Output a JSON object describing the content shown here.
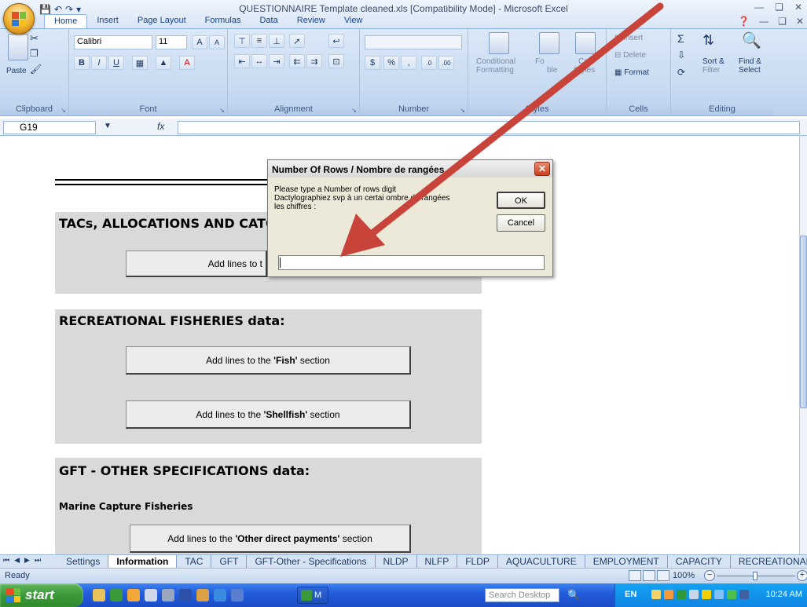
{
  "window": {
    "title": "QUESTIONNAIRE Template cleaned.xls  [Compatibility Mode] - Microsoft Excel"
  },
  "ribbon_tabs": [
    {
      "label": "Home"
    },
    {
      "label": "Insert"
    },
    {
      "label": "Page Layout"
    },
    {
      "label": "Formulas"
    },
    {
      "label": "Data"
    },
    {
      "label": "Review"
    },
    {
      "label": "View"
    }
  ],
  "ribbon": {
    "clipboard": {
      "label": "Clipboard",
      "paste": "Paste"
    },
    "font": {
      "label": "Font",
      "name": "Calibri",
      "size": "11",
      "bold": "B",
      "italic": "I",
      "underline": "U",
      "grow": "A",
      "shrink": "A"
    },
    "alignment": {
      "label": "Alignment"
    },
    "number": {
      "label": "Number",
      "format": "",
      "percent": "%",
      "comma": ","
    },
    "styles": {
      "label": "Styles",
      "conditional": "Conditional",
      "formatting": "Formatting",
      "format_table_1": "Fo",
      "format_table_2": "ble",
      "cell": "Cell",
      "cell_styles": "Styles"
    },
    "cells": {
      "label": "Cells",
      "insert": "Insert",
      "delete": "Delete",
      "format": "Format"
    },
    "editing": {
      "label": "Editing",
      "sort": "Sort &",
      "filter": "Filter",
      "find": "Find &",
      "select": "Select"
    }
  },
  "formula_bar": {
    "name_box": "G19",
    "fx": "fx",
    "value": ""
  },
  "sheet": {
    "tacs_title": "TACs, ALLOCATIONS AND CATC",
    "tacs_button_left": "Add lines to t",
    "rec_title": "RECREATIONAL FISHERIES data:",
    "fish_btn": {
      "pre": "Add lines to the ",
      "bold": "'Fish'",
      "post": " section"
    },
    "shellfish_btn": {
      "pre": "Add lines to the ",
      "bold": "'Shellfish'",
      "post": " section"
    },
    "gft_title": "GFT - OTHER SPECIFICATIONS data:",
    "marine_capture": "Marine Capture Fisheries",
    "other_payments_btn": {
      "pre": "Add lines to the ",
      "bold": "'Other direct payments'",
      "post": " section"
    }
  },
  "dialog": {
    "title": "Number Of Rows / Nombre de rangées",
    "prompt": "Please type a Number of rows digit\nDactylographiez svp à un certai   ombre de rangées\nles chiffres :",
    "ok": "OK",
    "cancel": "Cancel",
    "input_value": ""
  },
  "sheet_tabs": [
    {
      "label": "Settings"
    },
    {
      "label": "Information",
      "active": true
    },
    {
      "label": "TAC"
    },
    {
      "label": "GFT"
    },
    {
      "label": "GFT-Other - Specifications"
    },
    {
      "label": "NLDP"
    },
    {
      "label": "NLFP"
    },
    {
      "label": "FLDP"
    },
    {
      "label": "AQUACULTURE"
    },
    {
      "label": "EMPLOYMENT"
    },
    {
      "label": "CAPACITY"
    },
    {
      "label": "RECREATIONAL"
    }
  ],
  "status": {
    "ready": "Ready",
    "zoom": "100%",
    "zoom_level_pct": 100
  },
  "taskbar": {
    "start": "start",
    "excel_task": "M",
    "search_placeholder": "Search Desktop",
    "lang": "EN",
    "clock": "10:24 AM"
  },
  "colors": {
    "arrow": "#c8443a",
    "panel": "#d9d9d9",
    "taskbar": "#245edc",
    "start": "#3c9a3a"
  }
}
